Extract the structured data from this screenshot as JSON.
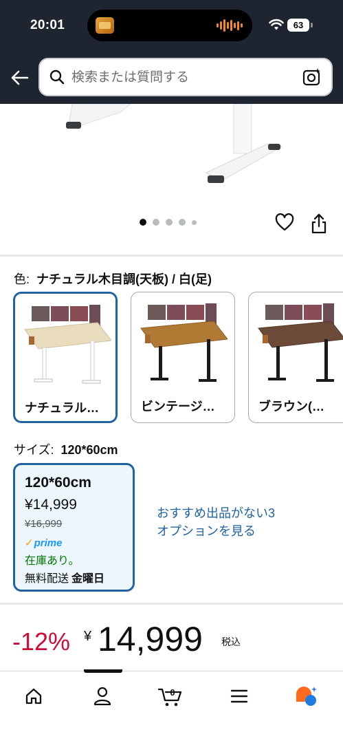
{
  "status_bar": {
    "time": "20:01",
    "battery": "63"
  },
  "search": {
    "placeholder": "検索または質問する"
  },
  "carousel": {
    "total_dots": 5,
    "active_index": 0
  },
  "color": {
    "label": "色:",
    "selected_value": "ナチュラル木目調(天板) / 白(足)",
    "options": [
      {
        "label": "ナチュラル…",
        "selected": true
      },
      {
        "label": "ビンテージ…",
        "selected": false
      },
      {
        "label": "ブラウン(…",
        "selected": false
      }
    ]
  },
  "size": {
    "label": "サイズ:",
    "selected_value": "120*60cm",
    "card": {
      "title": "120*60cm",
      "price": "¥14,999",
      "list_price": "¥16,999",
      "prime": "prime",
      "stock": "在庫あり。",
      "delivery_prefix": "無料配送",
      "delivery_day": "金曜日"
    },
    "other_offers": "おすすめ出品がない3オプションを見る"
  },
  "price_block": {
    "discount": "-12%",
    "currency": "¥",
    "price": "14,999",
    "tax": "税込"
  },
  "bottom_nav": {
    "cart_count": "0",
    "items": [
      "home-icon",
      "account-icon",
      "cart-icon",
      "menu-icon",
      "rufus-icon"
    ]
  },
  "colors": {
    "header_bg": "#1e2530",
    "selected_border": "#2162a1",
    "discount_red": "#cc0c39",
    "in_stock_green": "#007600",
    "prime_blue": "#1a98ff"
  }
}
